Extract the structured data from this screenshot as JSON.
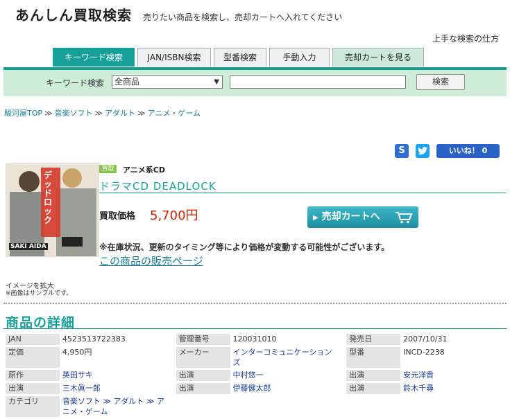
{
  "header": {
    "title": "あんしん買取検索",
    "tagline": "売りたい商品を検索し、売却カートへ入れてください",
    "help_link": "上手な検索の仕方"
  },
  "tabs": [
    {
      "label": "キーワード検索"
    },
    {
      "label": "JAN/ISBN検索"
    },
    {
      "label": "型番検索"
    },
    {
      "label": "手動入力"
    },
    {
      "label": "売却カートを見る"
    }
  ],
  "search": {
    "label": "キーワード検索",
    "category_selected": "全商品",
    "query": "",
    "button": "検索"
  },
  "breadcrumb": [
    "駿河屋TOP",
    "音楽ソフト",
    "アダルト",
    "アニメ・ゲーム"
  ],
  "share": {
    "s_label": "S",
    "like_label": "いいね！ 0"
  },
  "product": {
    "cover_title": "デッドロック",
    "cover_author": "SAKI AIDA",
    "badge": "買取",
    "category": "アニメ系CD",
    "title": "ドラマCD DEADLOCK",
    "price_label": "買取価格",
    "price": "5,700円",
    "cart_button": "売却カートへ",
    "notice": "※在庫状況、更新のタイミング等により価格が変動する可能性がございます。",
    "sales_link": "この商品の販売ページ",
    "enlarge": "イメージを拡大",
    "sample_note": "※画像はサンプルです。"
  },
  "details": {
    "heading": "商品の詳細",
    "rows": [
      [
        {
          "k": "JAN",
          "v": "4523513722383",
          "link": false
        },
        {
          "k": "管理番号",
          "v": "120031010",
          "link": false
        },
        {
          "k": "発売日",
          "v": "2007/10/31",
          "link": false
        }
      ],
      [
        {
          "k": "定価",
          "v": "4,950円",
          "link": false
        },
        {
          "k": "メーカー",
          "v": "インターコミュニケーションズ",
          "link": true
        },
        {
          "k": "型番",
          "v": "INCD-2238",
          "link": false
        }
      ],
      [
        {
          "k": "原作",
          "v": "英田サキ",
          "link": true
        },
        {
          "k": "出演",
          "v": "中村悠一",
          "link": true
        },
        {
          "k": "出演",
          "v": "安元洋貴",
          "link": true
        }
      ],
      [
        {
          "k": "出演",
          "v": "三木眞一郎",
          "link": true
        },
        {
          "k": "出演",
          "v": "伊藤健太郎",
          "link": true
        },
        {
          "k": "出演",
          "v": "鈴木千尋",
          "link": true
        }
      ],
      [
        {
          "k": "カテゴリ",
          "v": "音楽ソフト ≫ アダルト ≫ アニメ・ゲーム",
          "link": true
        }
      ]
    ]
  }
}
